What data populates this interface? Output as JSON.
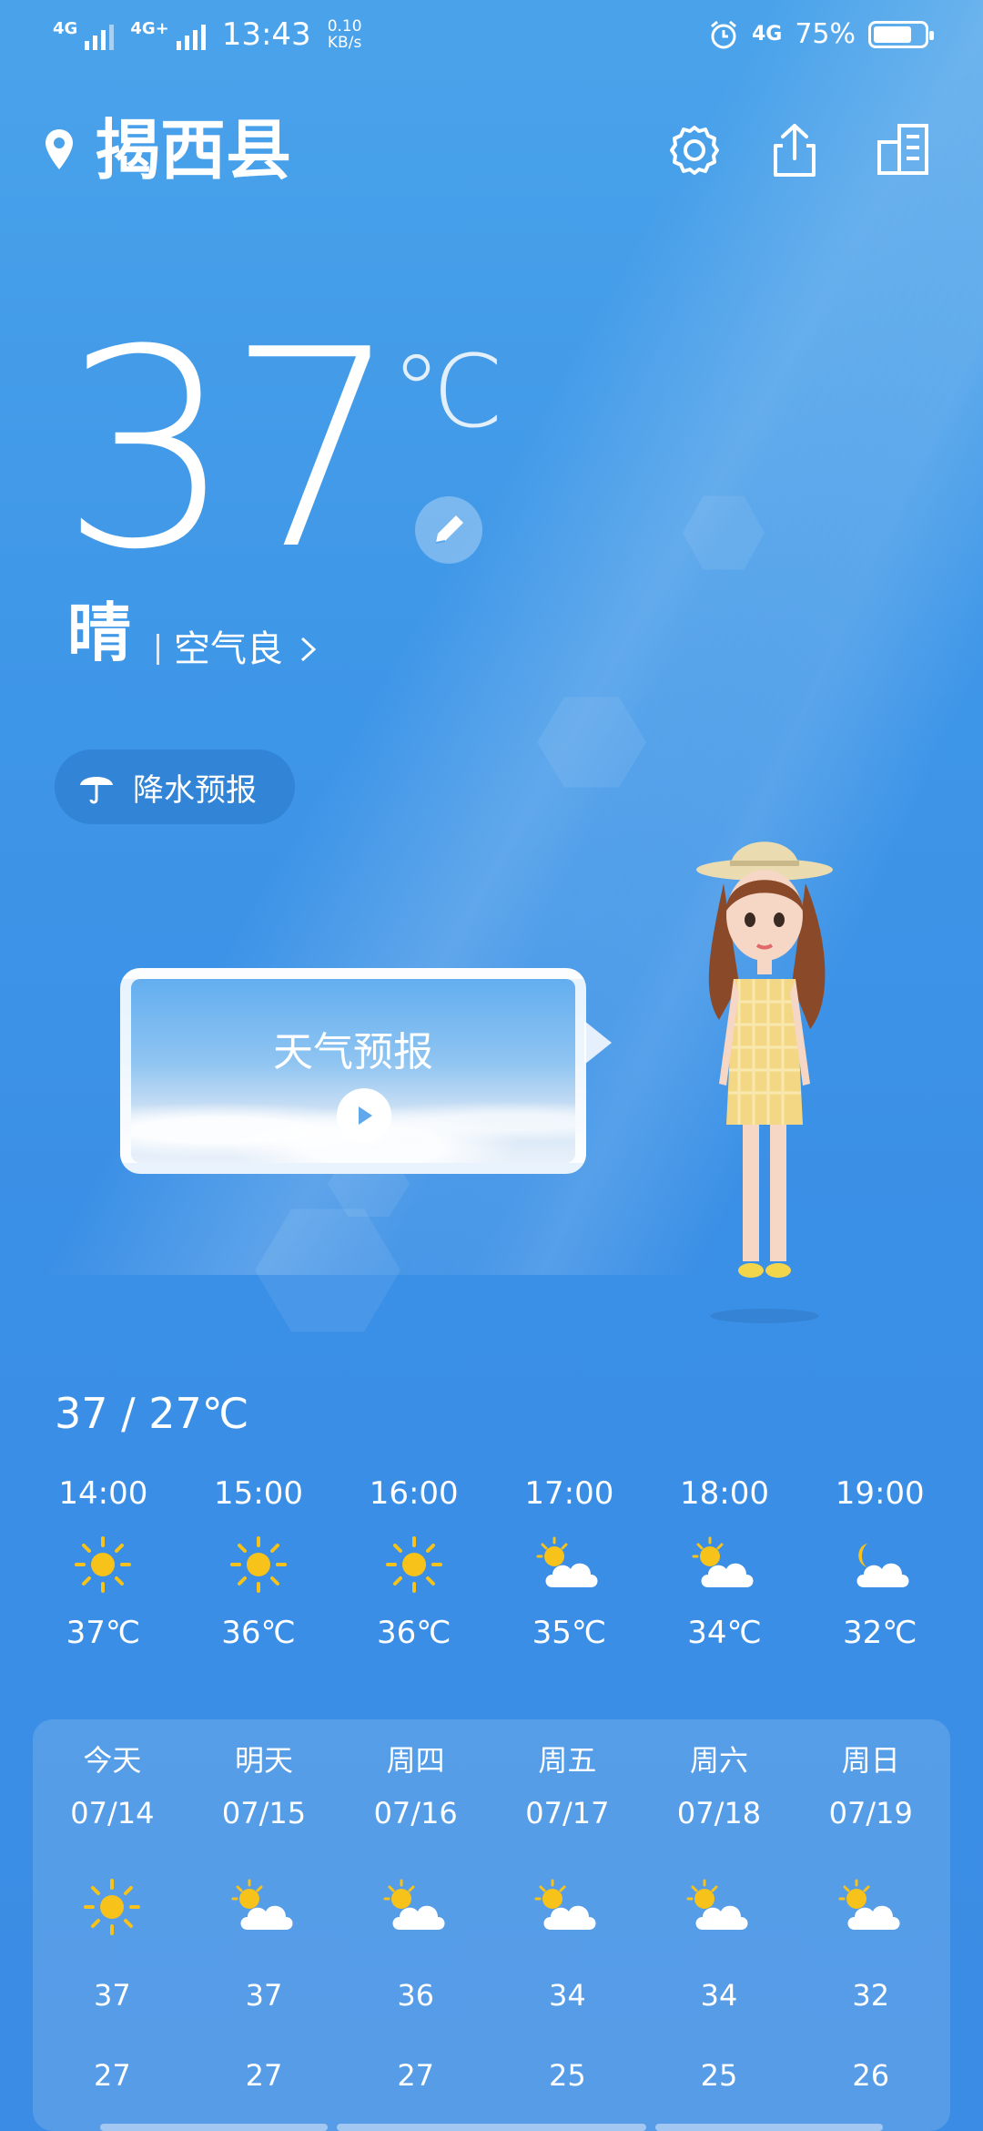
{
  "status_bar": {
    "network1": "4G",
    "network2": "4G+",
    "time": "13:43",
    "speed_value": "0.10",
    "speed_unit": "KB/s",
    "network3": "4G",
    "battery": "75%",
    "battery_level": 0.75
  },
  "header": {
    "city": "揭西县",
    "icons": [
      "location-pin-icon",
      "gear-icon",
      "share-icon",
      "city-manage-icon"
    ]
  },
  "current": {
    "temperature": "37",
    "unit": "℃",
    "condition": "晴",
    "air_quality": "空气良",
    "rain_forecast": "降水预报"
  },
  "video": {
    "title": "天气预报"
  },
  "today_range": "37 / 27℃",
  "hourly": [
    {
      "time": "14:00",
      "icon": "sun",
      "temp": "37℃"
    },
    {
      "time": "15:00",
      "icon": "sun",
      "temp": "36℃"
    },
    {
      "time": "16:00",
      "icon": "sun",
      "temp": "36℃"
    },
    {
      "time": "17:00",
      "icon": "partly-cloudy",
      "temp": "35℃"
    },
    {
      "time": "18:00",
      "icon": "partly-cloudy",
      "temp": "34℃"
    },
    {
      "time": "19:00",
      "icon": "night-cloudy",
      "temp": "32℃"
    }
  ],
  "daily": [
    {
      "name": "今天",
      "date": "07/14",
      "icon": "sun",
      "high": "37",
      "low": "27"
    },
    {
      "name": "明天",
      "date": "07/15",
      "icon": "partly-cloudy",
      "high": "37",
      "low": "27"
    },
    {
      "name": "周四",
      "date": "07/16",
      "icon": "partly-cloudy",
      "high": "36",
      "low": "27"
    },
    {
      "name": "周五",
      "date": "07/17",
      "icon": "partly-cloudy",
      "high": "34",
      "low": "25"
    },
    {
      "name": "周六",
      "date": "07/18",
      "icon": "partly-cloudy",
      "high": "34",
      "low": "25"
    },
    {
      "name": "周日",
      "date": "07/19",
      "icon": "partly-cloudy",
      "high": "32",
      "low": "26"
    }
  ],
  "colors": {
    "sun": "#f7c21a",
    "cloud": "#ffffff",
    "background": "#3f97e8"
  }
}
